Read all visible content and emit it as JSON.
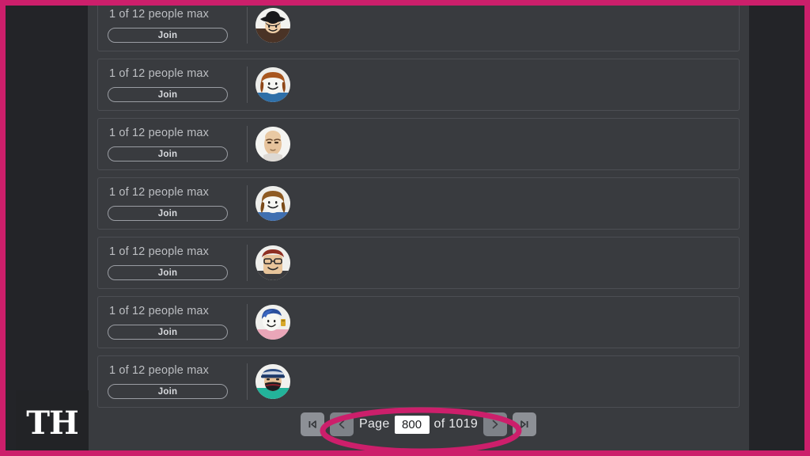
{
  "annotation": {
    "frame_color": "#cc1f6b",
    "highlight_color": "#cc1f6b",
    "highlight_target": "pagination-controls"
  },
  "watermark": {
    "text": "TH"
  },
  "servers": {
    "join_label": "Join",
    "rows": [
      {
        "capacity_text": "1 of 12 people max",
        "avatar": "avatar-black-hat"
      },
      {
        "capacity_text": "1 of 12 people max",
        "avatar": "avatar-orange-hair"
      },
      {
        "capacity_text": "1 of 12 people max",
        "avatar": "avatar-bald-white"
      },
      {
        "capacity_text": "1 of 12 people max",
        "avatar": "avatar-brown-bob"
      },
      {
        "capacity_text": "1 of 12 people max",
        "avatar": "avatar-glasses-red-hair"
      },
      {
        "capacity_text": "1 of 12 people max",
        "avatar": "avatar-blue-hair-pink"
      },
      {
        "capacity_text": "1 of 12 people max",
        "avatar": "avatar-mask-cap"
      }
    ]
  },
  "pagination": {
    "first_icon": "first-page-icon",
    "prev_icon": "previous-page-icon",
    "next_icon": "next-page-icon",
    "last_icon": "last-page-icon",
    "page_label": "Page",
    "page_value": "800",
    "of_label": "of 1019",
    "total_pages": "1019",
    "current_page": "800"
  }
}
